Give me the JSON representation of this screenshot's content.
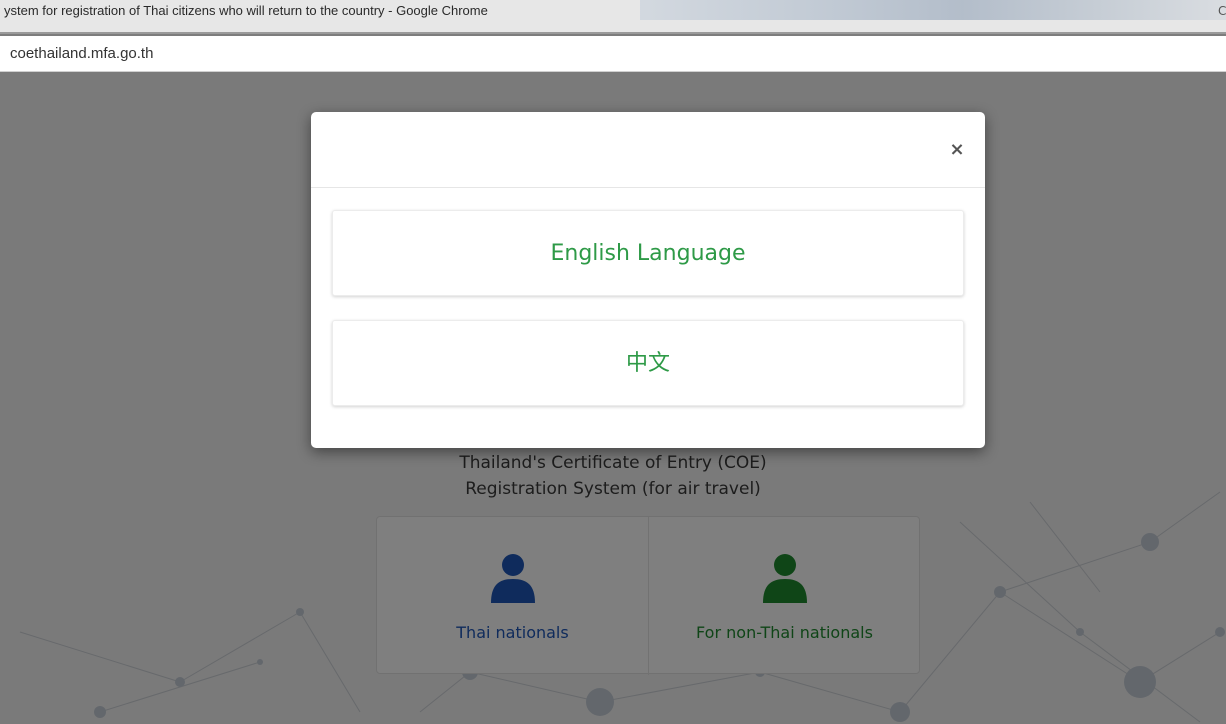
{
  "browser": {
    "window_title": "ystem for registration of Thai citizens who will return to the country - Google Chrome",
    "url": "coethailand.mfa.go.th"
  },
  "page": {
    "heading_line1": "Thailand's Certificate of Entry (COE)",
    "heading_line2": "Registration System (for air travel)",
    "choices": [
      {
        "label": "Thai nationals",
        "icon": "person-icon",
        "color": "#1f57b8"
      },
      {
        "label": "For non-Thai nationals",
        "icon": "person-icon",
        "color": "#1f8a2f"
      }
    ]
  },
  "modal": {
    "close_label": "×",
    "languages": [
      {
        "label": "English Language"
      },
      {
        "label": "中文"
      }
    ],
    "accent_color": "#2e9a47"
  }
}
